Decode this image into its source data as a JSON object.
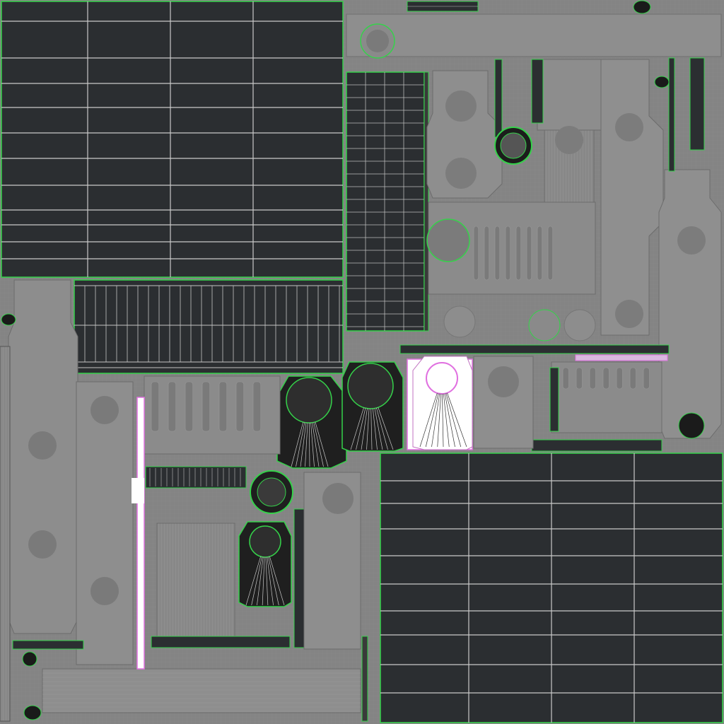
{
  "texture_sheet": {
    "description_label": "",
    "colors": {
      "background": "#7a7a7a",
      "gray_island": "#8c8c8c",
      "dark_panel": "#2b2e31",
      "wire_gray": "#c8c8c8",
      "seam_green": "#35d24a",
      "selected_pink": "#e070e0",
      "selected_fill": "#ffffff",
      "shadow": "#1a1a1a"
    },
    "islands": {
      "solar_panel_large": "solar-panel-uv-island",
      "solar_panel_tall": "solar-panel-strip-uv-island",
      "solar_panel_wide": "solar-panel-row-uv-island",
      "solar_panel_bottom": "solar-panel-bottom-uv-island",
      "fuel_tanks": "fuel-tank-uv-island",
      "dome_caps": "dome-cap-uv-island",
      "selected_cap": "selected-cap-uv-island",
      "selected_rail": "selected-rail-uv-island"
    }
  }
}
